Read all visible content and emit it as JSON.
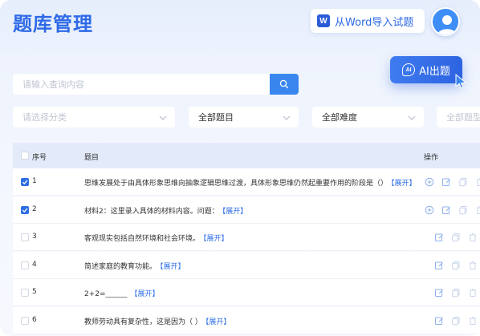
{
  "header": {
    "title": "题库管理",
    "import_button_label": "从Word导入试题",
    "word_icon_letter": "W"
  },
  "search": {
    "placeholder": "请输入查询内容"
  },
  "ai_button": {
    "label": "AI出题",
    "icon_text": "AI"
  },
  "filters": {
    "category_placeholder": "请选择分类",
    "question_type": "全部题目",
    "difficulty": "全部难度",
    "more": "全部题型"
  },
  "table": {
    "headers": {
      "no": "序号",
      "question": "题目",
      "operations": "操作"
    },
    "expand_label": "【展开】",
    "rows": [
      {
        "no": "1",
        "question": "思维发展处于由具体形象思维向抽象逻辑思维过渡，具体形象思维仍然起重要作用的阶段是（）",
        "checked": true,
        "has_add": true
      },
      {
        "no": "2",
        "question": "材料2：这里录入具体的材料内容。问题：",
        "checked": true,
        "has_add": true
      },
      {
        "no": "3",
        "question": "客观现实包括自然环境和社会环境。",
        "checked": false,
        "has_add": false
      },
      {
        "no": "4",
        "question": "简述家庭的教育功能。",
        "checked": false,
        "has_add": false
      },
      {
        "no": "5",
        "question": "2+2=______",
        "checked": false,
        "has_add": false
      },
      {
        "no": "6",
        "question": "教师劳动具有复杂性，这是因为（ ）",
        "checked": false,
        "has_add": false
      }
    ]
  },
  "colors": {
    "accent": "#2e6ae6",
    "primary_button": "#3a86ef",
    "header_bg": "#e3ebfb"
  },
  "icons": [
    "word-icon",
    "user-avatar-icon",
    "search-icon",
    "ai-icon",
    "cursor-icon",
    "chevron-down-icon",
    "add-circle-icon",
    "edit-icon",
    "copy-icon",
    "delete-icon"
  ]
}
